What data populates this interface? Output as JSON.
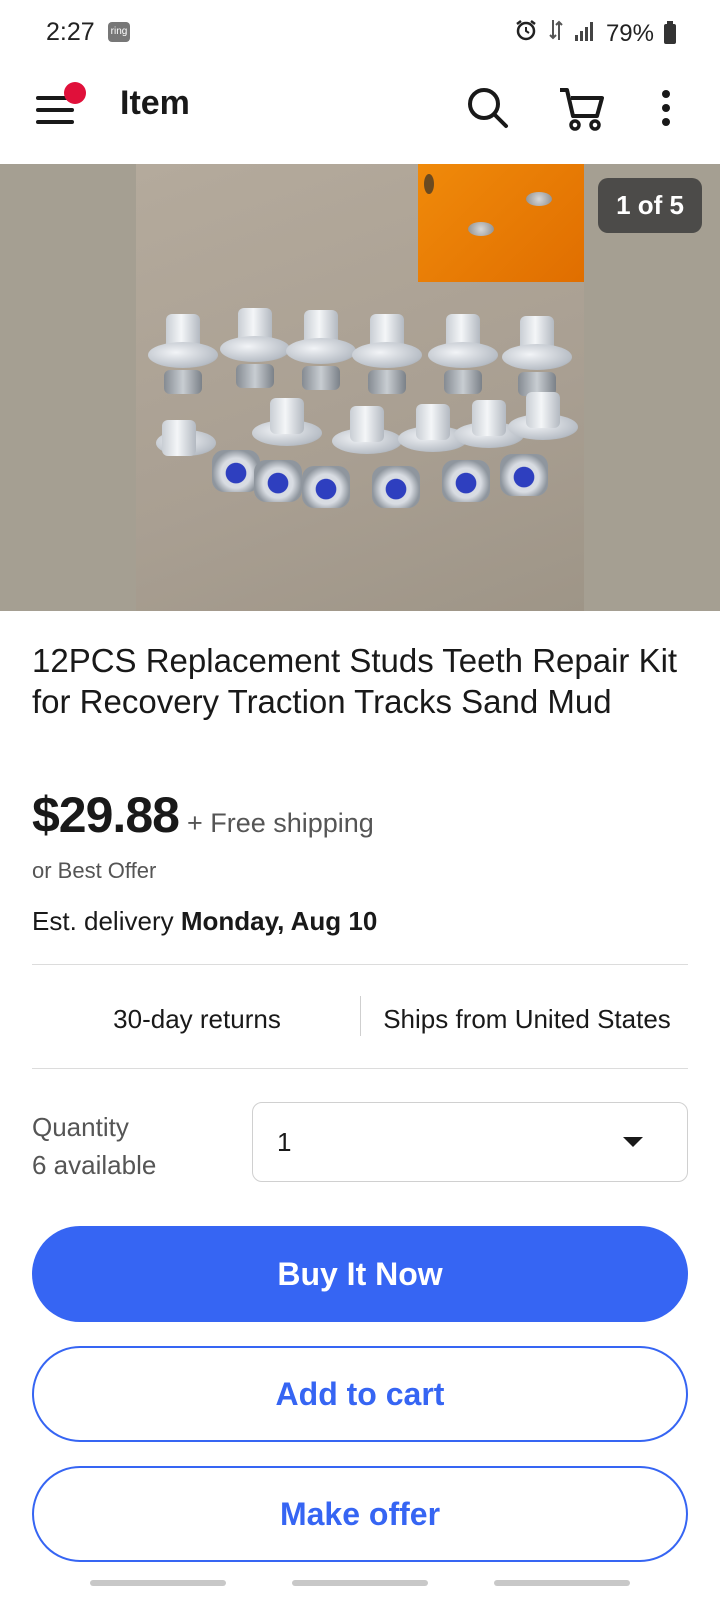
{
  "status_bar": {
    "time": "2:27",
    "ring_badge": "ring",
    "signal": "ıııl",
    "battery": "79%"
  },
  "app_bar": {
    "title": "Item",
    "icons": [
      "menu-icon",
      "search-icon",
      "cart-icon",
      "more-vert-icon"
    ],
    "notification_color": "#e0103a"
  },
  "gallery": {
    "counter": "1 of 5"
  },
  "item": {
    "title": "12PCS Replacement Studs Teeth Repair Kit for Recovery Traction Tracks Sand Mud",
    "price": "$29.88",
    "shipping": "+ Free shipping",
    "best_offer": "or Best Offer",
    "delivery_prefix": "Est. delivery",
    "delivery_date": "Monday, Aug 10",
    "returns": "30-day returns",
    "ships_from": "Ships from United States"
  },
  "quantity": {
    "label": "Quantity",
    "available": "6 available",
    "value": "1"
  },
  "actions": {
    "buy_now": "Buy It Now",
    "add_to_cart": "Add to cart",
    "make_offer": "Make offer"
  },
  "colors": {
    "accent": "#3665f3",
    "text": "#191919",
    "secondary_text": "#555555"
  }
}
